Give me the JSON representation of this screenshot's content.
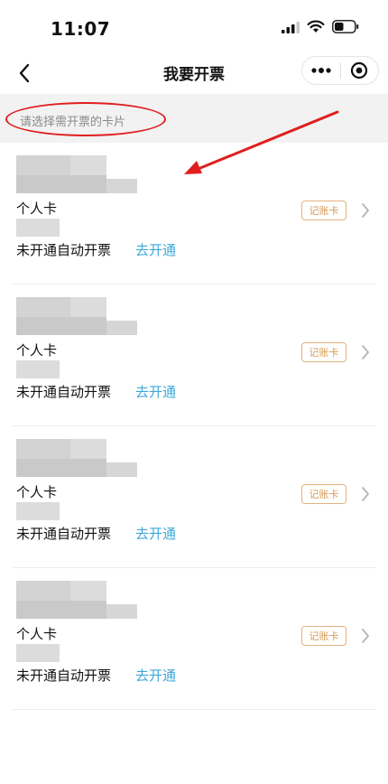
{
  "status_bar": {
    "time": "11:07"
  },
  "nav": {
    "title": "我要开票"
  },
  "hint": {
    "text": "请选择需开票的卡片"
  },
  "cards": [
    {
      "type": "个人卡",
      "badge": "记账卡",
      "status": "未开通自动开票",
      "action": "去开通"
    },
    {
      "type": "个人卡",
      "badge": "记账卡",
      "status": "未开通自动开票",
      "action": "去开通"
    },
    {
      "type": "个人卡",
      "badge": "记账卡",
      "status": "未开通自动开票",
      "action": "去开通"
    },
    {
      "type": "个人卡",
      "badge": "记账卡",
      "status": "未开通自动开票",
      "action": "去开通"
    }
  ],
  "annotation_color": "#e01e1e",
  "accent_color": "#3ea8d8",
  "badge_color": "#d69a55"
}
